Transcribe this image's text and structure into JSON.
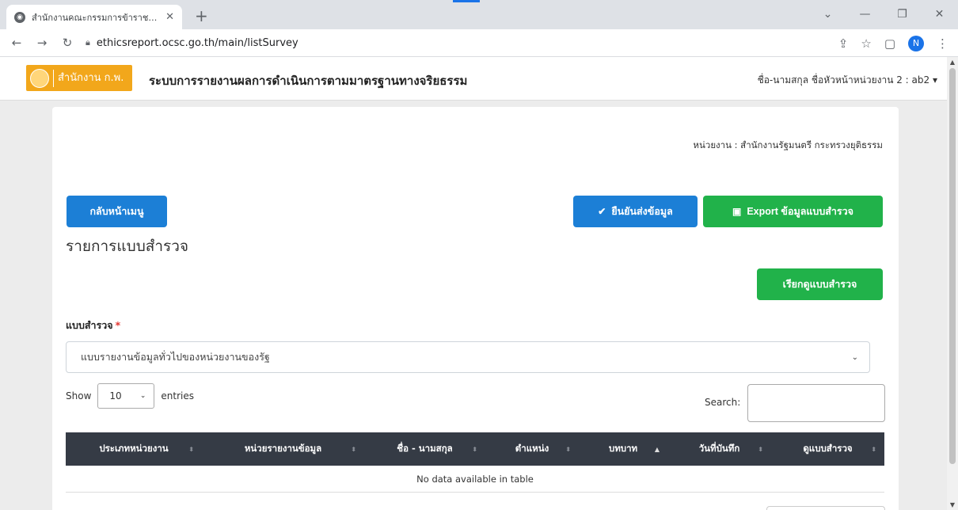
{
  "browser": {
    "tab_title": "สำนักงานคณะกรรมการข้าราชการพลเ",
    "url": "ethicsreport.ocsc.go.th/main/listSurvey",
    "profile_initial": "N"
  },
  "header": {
    "logo_text": "สำนักงาน ก.พ.",
    "app_title": "ระบบการรายงานผลการดำเนินการตามมาตรฐานทางจริยธรรม",
    "user_menu": "ชื่อ-นามสกุล ชื่อหัวหน้าหน่วยงาน 2 : ab2"
  },
  "main": {
    "agency": "หน่วยงาน : สำนักงานรัฐมนตรี กระทรวงยุติธรรม",
    "back_button": "กลับหน้าเมนู",
    "confirm_button": "ยืนยันส่งข้อมูล",
    "export_button": "Export ข้อมูลแบบสำรวจ",
    "section_title": "รายการแบบสำรวจ",
    "view_button": "เรียกดูแบบสำรวจ",
    "survey_label": "แบบสำรวจ",
    "required_mark": "*",
    "survey_selected": "แบบรายงานข้อมูลทั่วไปของหน่วยงานของรัฐ",
    "show_label": "Show",
    "entries_value": "10",
    "entries_label": "entries",
    "search_label": "Search:",
    "search_value": ""
  },
  "table": {
    "columns": [
      "ประเภทหน่วยงาน",
      "หน่วยรายงานข้อมูล",
      "ชื่อ - นามสกุล",
      "ตำแหน่ง",
      "บทบาท",
      "วันที่บันทึก",
      "ดูแบบสำรวจ"
    ],
    "empty_message": "No data available in table"
  },
  "colors": {
    "primary": "#1c7fd6",
    "success": "#21b24a",
    "table_header": "#353b45",
    "logo": "#f2a71b"
  }
}
